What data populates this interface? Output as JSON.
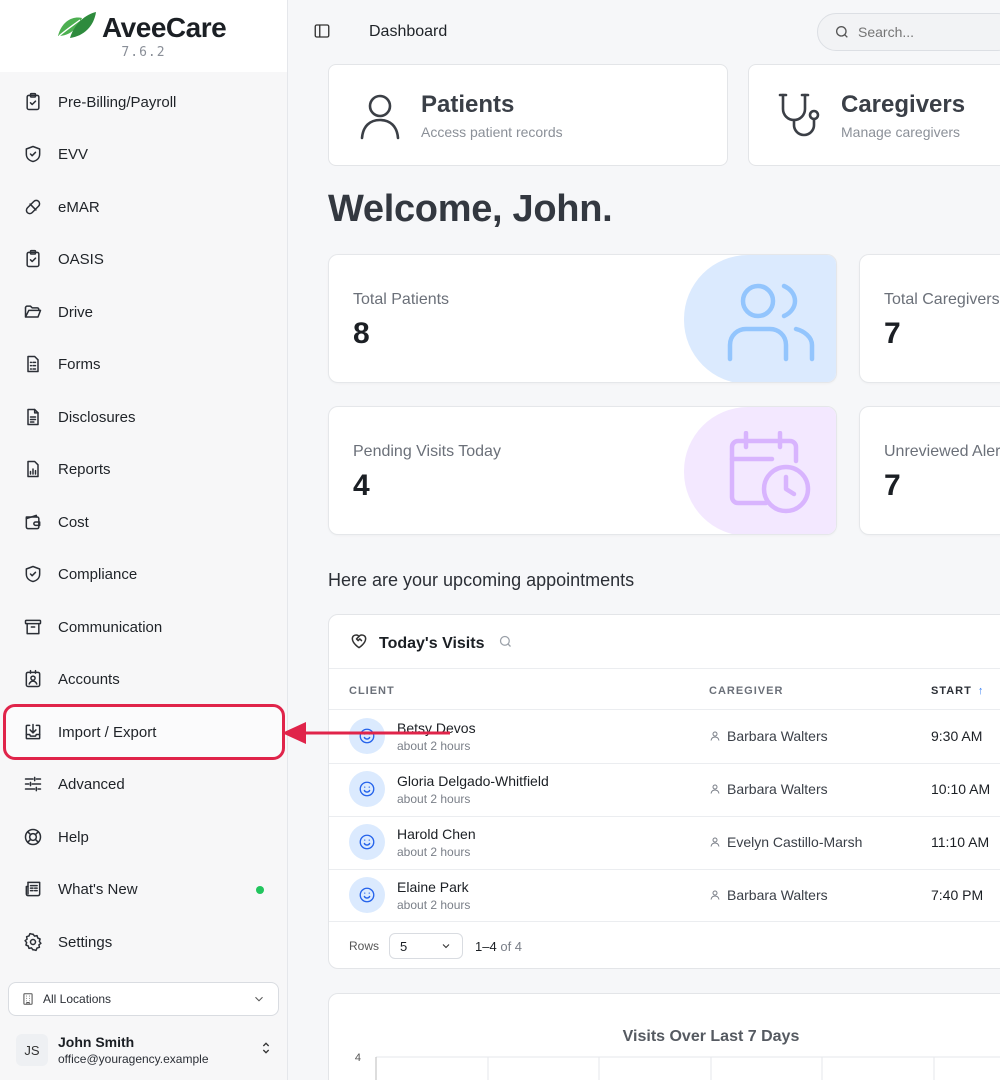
{
  "app": {
    "name": "AveeCare",
    "version": "7.6.2"
  },
  "sidebar": {
    "items": [
      {
        "label": "Pre-Billing/Payroll",
        "icon": "clipboard-check-icon"
      },
      {
        "label": "EVV",
        "icon": "shield-check-icon"
      },
      {
        "label": "eMAR",
        "icon": "pill-icon"
      },
      {
        "label": "OASIS",
        "icon": "clipboard-check-icon"
      },
      {
        "label": "Drive",
        "icon": "folder-open-icon"
      },
      {
        "label": "Forms",
        "icon": "form-icon"
      },
      {
        "label": "Disclosures",
        "icon": "document-icon"
      },
      {
        "label": "Reports",
        "icon": "report-chart-icon"
      },
      {
        "label": "Cost",
        "icon": "wallet-icon"
      },
      {
        "label": "Compliance",
        "icon": "shield-check-icon"
      },
      {
        "label": "Communication",
        "icon": "archive-box-icon"
      },
      {
        "label": "Accounts",
        "icon": "contact-card-icon"
      },
      {
        "label": "Import / Export",
        "icon": "import-icon"
      },
      {
        "label": "Advanced",
        "icon": "sliders-icon"
      },
      {
        "label": "Help",
        "icon": "lifebuoy-icon"
      },
      {
        "label": "What's New",
        "icon": "newspaper-icon"
      },
      {
        "label": "Settings",
        "icon": "gear-icon"
      }
    ],
    "location_select": "All Locations",
    "user": {
      "initials": "JS",
      "name": "John Smith",
      "email": "office@youragency.example"
    }
  },
  "topbar": {
    "breadcrumb": "Dashboard",
    "search_placeholder": "Search..."
  },
  "quick_links": [
    {
      "title": "Patients",
      "subtitle": "Access patient records",
      "icon": "user-icon"
    },
    {
      "title": "Caregivers",
      "subtitle": "Manage caregivers",
      "icon": "stethoscope-icon"
    }
  ],
  "welcome": "Welcome, John.",
  "stats": [
    {
      "label": "Total Patients",
      "value": "8",
      "icon": "users-icon",
      "color": "#dbeafe",
      "icon_color": "#93c5fd"
    },
    {
      "label": "Total Caregivers",
      "value": "7"
    },
    {
      "label": "Pending Visits Today",
      "value": "4",
      "icon": "calendar-clock-icon",
      "color": "#f3e8ff",
      "icon_color": "#d8b4fe"
    },
    {
      "label": "Unreviewed Alerts",
      "value": "7"
    }
  ],
  "appointments": {
    "section_title": "Here are your upcoming appointments",
    "title": "Today's Visits",
    "columns": [
      "CLIENT",
      "CAREGIVER",
      "START"
    ],
    "rows": [
      {
        "client": "Betsy Devos",
        "relative": "about 2 hours",
        "caregiver": "Barbara Walters",
        "start": "9:30 AM"
      },
      {
        "client": "Gloria Delgado-Whitfield",
        "relative": "about 2 hours",
        "caregiver": "Barbara Walters",
        "start": "10:10 AM"
      },
      {
        "client": "Harold Chen",
        "relative": "about 2 hours",
        "caregiver": "Evelyn Castillo-Marsh",
        "start": "11:10 AM"
      },
      {
        "client": "Elaine Park",
        "relative": "about 2 hours",
        "caregiver": "Barbara Walters",
        "start": "7:40 PM"
      }
    ],
    "rows_label": "Rows",
    "rows_per_page": "5",
    "range": "1–4",
    "range_of": "of 4"
  },
  "chart_data": {
    "type": "bar",
    "title": "Visits Over Last 7 Days",
    "y_ticks": [
      "4"
    ]
  },
  "colors": {
    "accent_red": "#e0244a",
    "new_dot": "#22c55e",
    "brand_green": "#3aa14a"
  }
}
